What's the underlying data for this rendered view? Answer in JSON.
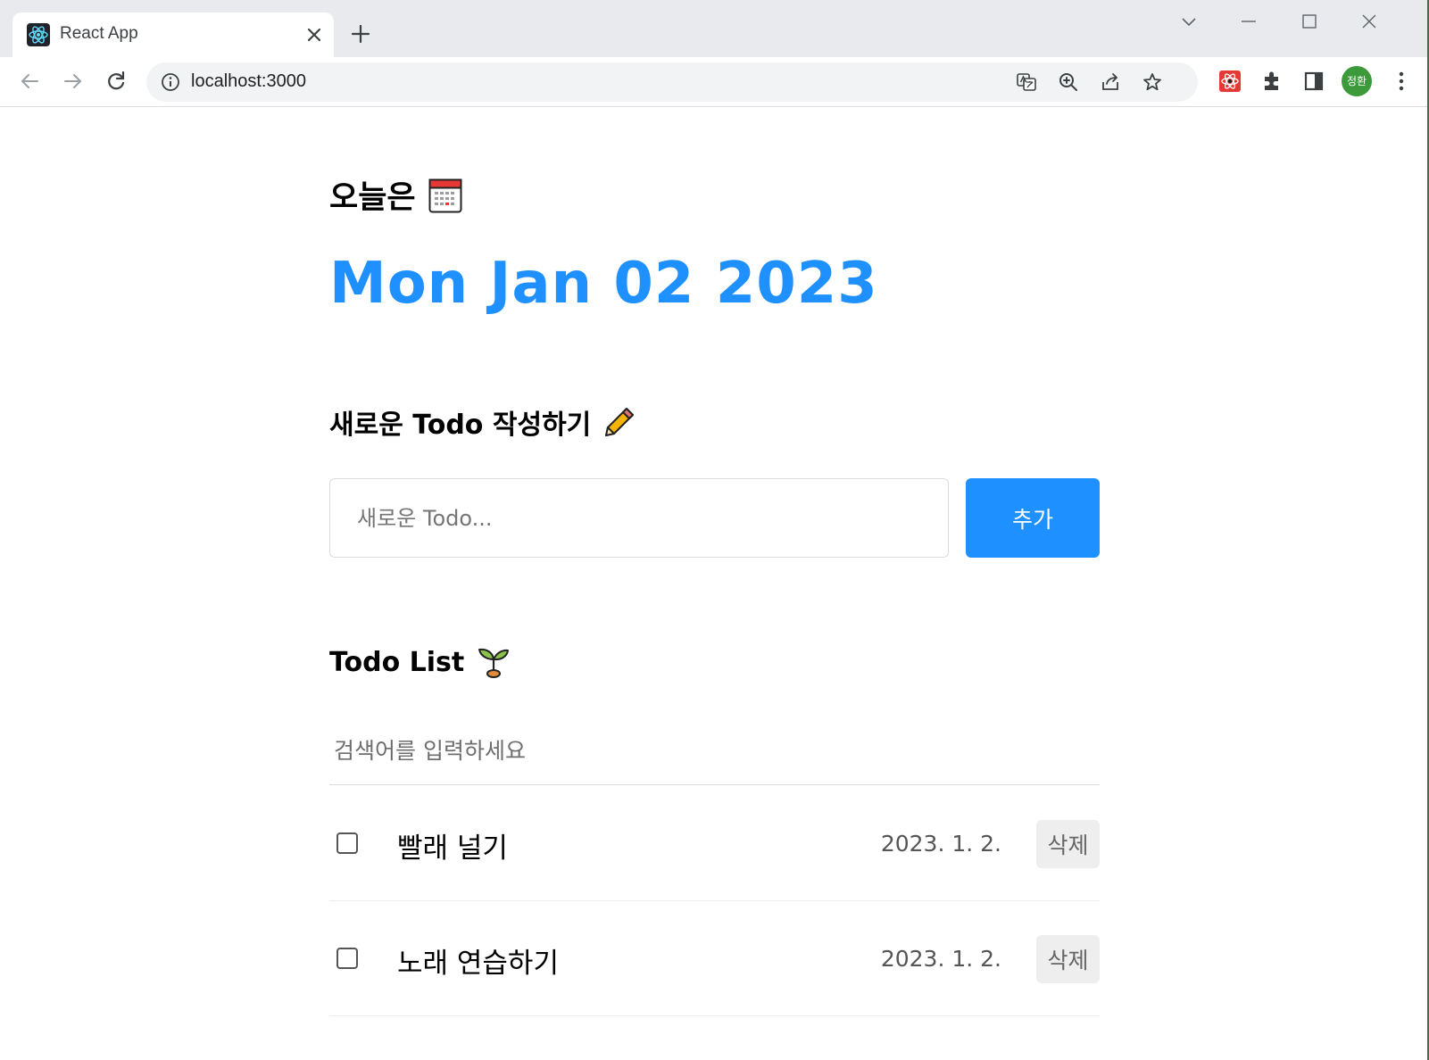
{
  "browser": {
    "tab": {
      "title": "React App",
      "favicon": "react-logo-icon"
    },
    "address": {
      "url": "localhost:3000"
    },
    "profile_label": "정환"
  },
  "header": {
    "today_label": "오늘은",
    "today_icon": "calendar-icon",
    "date": "Mon Jan 02 2023"
  },
  "editor": {
    "title": "새로운 Todo 작성하기",
    "title_icon": "pencil-icon",
    "input_placeholder": "새로운 Todo...",
    "add_label": "추가"
  },
  "list": {
    "title": "Todo List",
    "title_icon": "seedling-icon",
    "search_placeholder": "검색어를 입력하세요",
    "delete_label": "삭제",
    "items": [
      {
        "text": "빨래 널기",
        "date": "2023. 1. 2.",
        "done": false
      },
      {
        "text": "노래 연습하기",
        "date": "2023. 1. 2.",
        "done": false
      }
    ]
  },
  "colors": {
    "accent": "#1e90ff",
    "chrome_bg": "#e8eaed",
    "omnibox_bg": "#f1f3f4"
  }
}
